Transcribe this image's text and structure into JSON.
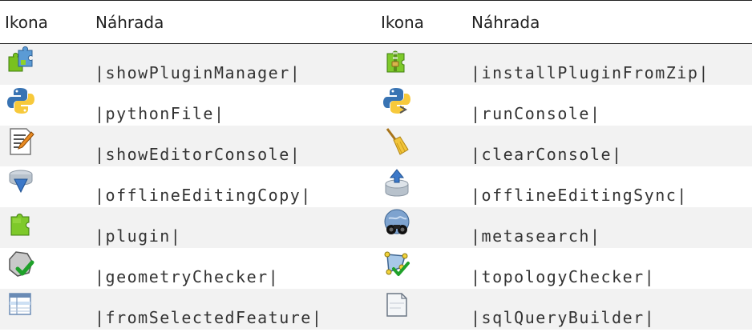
{
  "header": {
    "icon_label": "Ikona",
    "replacement_label": "Náhrada"
  },
  "rows": [
    {
      "left": {
        "icon": "plugin-manager-icon",
        "code": "|showPluginManager|"
      },
      "right": {
        "icon": "install-plugin-from-zip-icon",
        "code": "|installPluginFromZip|"
      }
    },
    {
      "left": {
        "icon": "python-file-icon",
        "code": "|pythonFile|"
      },
      "right": {
        "icon": "run-console-icon",
        "code": "|runConsole|"
      }
    },
    {
      "left": {
        "icon": "editor-console-icon",
        "code": "|showEditorConsole|"
      },
      "right": {
        "icon": "clear-console-broom-icon",
        "code": "|clearConsole|"
      }
    },
    {
      "left": {
        "icon": "offline-editing-copy-icon",
        "code": "|offlineEditingCopy|"
      },
      "right": {
        "icon": "offline-editing-sync-icon",
        "code": "|offlineEditingSync|"
      }
    },
    {
      "left": {
        "icon": "plugin-puzzle-icon",
        "code": "|plugin|"
      },
      "right": {
        "icon": "metasearch-binoculars-icon",
        "code": "|metasearch|"
      }
    },
    {
      "left": {
        "icon": "geometry-checker-icon",
        "code": "|geometryChecker|"
      },
      "right": {
        "icon": "topology-checker-icon",
        "code": "|topologyChecker|"
      }
    },
    {
      "left": {
        "icon": "from-selected-feature-icon",
        "code": "|fromSelectedFeature|"
      },
      "right": {
        "icon": "sql-query-builder-icon",
        "code": "|sqlQueryBuilder|"
      }
    }
  ]
}
